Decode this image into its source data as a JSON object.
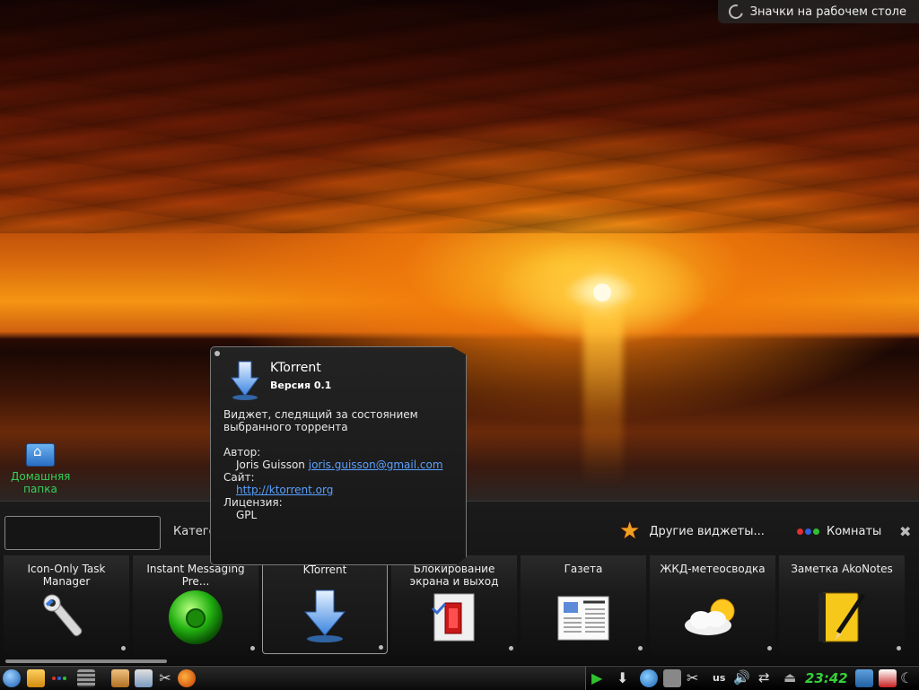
{
  "desktop": {
    "toolbox_label": "Значки на рабочем столе",
    "home_icon_label": "Домашняя папка"
  },
  "explorer": {
    "search_placeholder": "",
    "categories_label": "Категории",
    "other_widgets_label": "Другие виджеты...",
    "activities_label": "Комнаты",
    "widgets": [
      {
        "name": "Icon-Only Task Manager",
        "icon": "wrench-icon"
      },
      {
        "name": "Instant Messaging Pre...",
        "icon": "green-status-orb-icon"
      },
      {
        "name": "KTorrent",
        "icon": "download-arrow-icon",
        "selected": true
      },
      {
        "name": "Блокирование экрана и выход",
        "icon": "lock-door-icon"
      },
      {
        "name": "Газета",
        "icon": "newspaper-icon"
      },
      {
        "name": "ЖКД-метеосводка",
        "icon": "weather-sun-cloud-icon"
      },
      {
        "name": "Заметка AkoNotes",
        "icon": "notebook-pen-icon"
      }
    ]
  },
  "tooltip": {
    "title": "KTorrent",
    "version": "Версия 0.1",
    "description": "Виджет, следящий за состоянием выбранного торрента",
    "author_label": "Автор:",
    "author_name": "Joris Guisson",
    "author_email": "joris.guisson@gmail.com",
    "site_label": "Сайт:",
    "site_url": "http://ktorrent.org",
    "license_label": "Лицензия:",
    "license": "GPL"
  },
  "taskbar": {
    "keyboard_layout": "us",
    "clock": "23:42"
  },
  "colors": {
    "clock": "#36d03a",
    "link": "#5aa0ff",
    "home_label": "#34d058"
  }
}
